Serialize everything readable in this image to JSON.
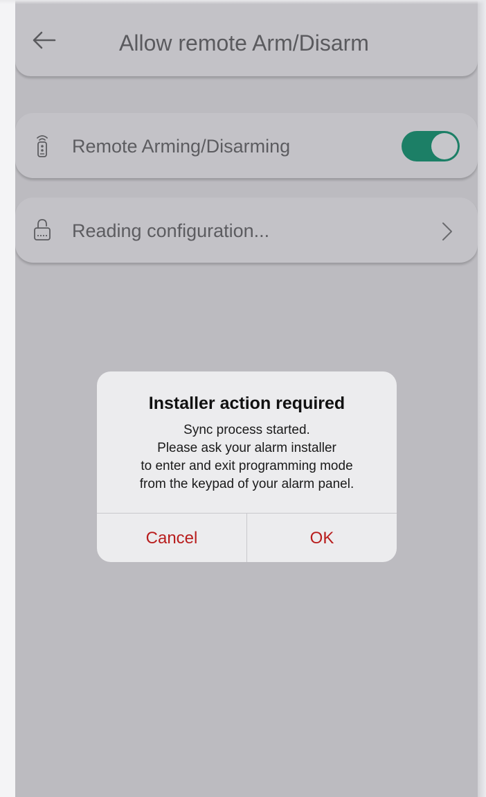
{
  "header": {
    "title": "Allow remote Arm/Disarm",
    "back_icon": "arrow-left-icon"
  },
  "settings": {
    "remote": {
      "label": "Remote Arming/Disarming",
      "icon": "remote-control-icon",
      "enabled": true,
      "toggle_color": "#1c7f66"
    },
    "config": {
      "label": "Reading configuration...",
      "icon": "lock-keypad-icon",
      "chevron_icon": "chevron-right-icon"
    }
  },
  "dialog": {
    "title": "Installer action required",
    "message_lines": [
      "Sync process started.",
      "Please ask your alarm installer",
      "to enter and exit programming mode",
      "from the keypad of your alarm panel."
    ],
    "cancel_label": "Cancel",
    "ok_label": "OK",
    "button_color": "#b81d1d"
  },
  "colors": {
    "overlay": "#bcbbc0",
    "card": "#c3c2c7",
    "dialog": "#ececee"
  }
}
